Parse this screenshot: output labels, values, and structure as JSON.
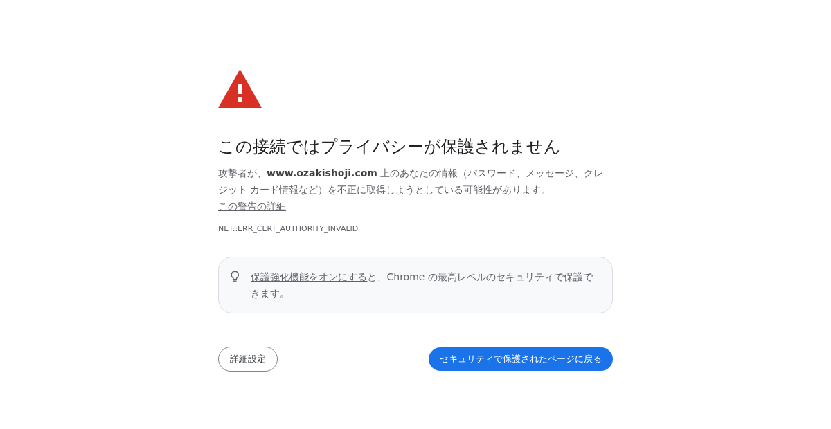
{
  "title": "この接続ではプライバシーが保護されません",
  "message": {
    "text": "攻撃者が、**www.ozakishoji.com** 上のあなたの情報（パスワード、メッセージ、クレジット カード情報など）を不正に取得しようとしている可能性があります。",
    "link": "この警告の詳細"
  },
  "error_code": "NET::ERR_CERT_AUTHORITY_INVALID",
  "tip": {
    "link": "保護強化機能をオンにする",
    "text": "と、Chrome の最高レベルのセキュリティで保護できます。"
  },
  "buttons": [
    {
      "label": "詳細設定",
      "kind": "secondary"
    },
    {
      "label": "セキュリティで保護されたページに戻る",
      "kind": "primary"
    }
  ]
}
